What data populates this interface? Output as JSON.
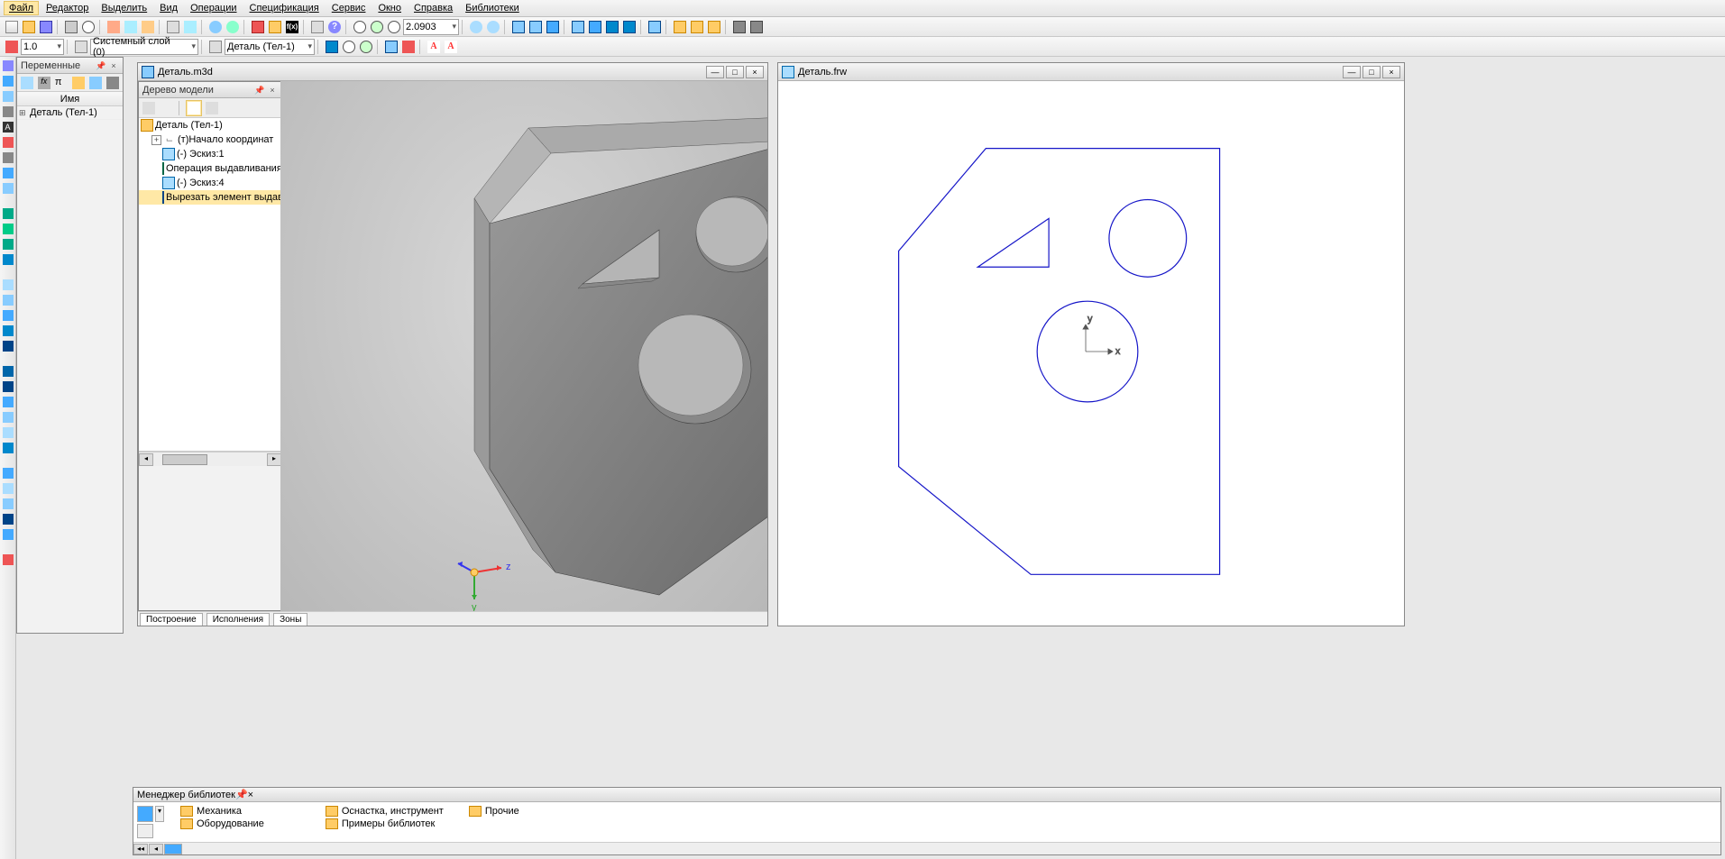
{
  "menu": {
    "file": "Файл",
    "edit": "Редактор",
    "select": "Выделить",
    "view": "Вид",
    "ops": "Операции",
    "spec": "Спецификация",
    "service": "Сервис",
    "window": "Окно",
    "help": "Справка",
    "libs": "Библиотеки"
  },
  "toolbar2": {
    "scale": "1.0",
    "layer": "Системный слой (0)",
    "part": "Деталь (Тел-1)",
    "zoom_val": "2.0903",
    "fn_label": "f(x)"
  },
  "vars_panel": {
    "title": "Переменные",
    "col_name": "Имя",
    "root": "Деталь (Тел-1)"
  },
  "tree_panel": {
    "title": "Дерево модели",
    "root": "Деталь (Тел-1)",
    "nodes": {
      "origin": "(т)Начало координат",
      "sketch1": "(-) Эскиз:1",
      "extrude": "Операция выдавливания",
      "sketch4": "(-) Эскиз:4",
      "cut": "Вырезать элемент выдав"
    }
  },
  "doc3d": {
    "title": "Деталь.m3d",
    "axis_z": "z",
    "axis_y": "y"
  },
  "doc2d": {
    "title": "Деталь.frw",
    "axis_x": "x",
    "axis_y": "y"
  },
  "tabs3d": {
    "build": "Построение",
    "exec": "Исполнения",
    "zones": "Зоны"
  },
  "libmgr": {
    "title": "Менеджер библиотек",
    "mech": "Механика",
    "equip": "Оборудование",
    "tooling": "Оснастка, инструмент",
    "examples": "Примеры библиотек",
    "other": "Прочие"
  }
}
